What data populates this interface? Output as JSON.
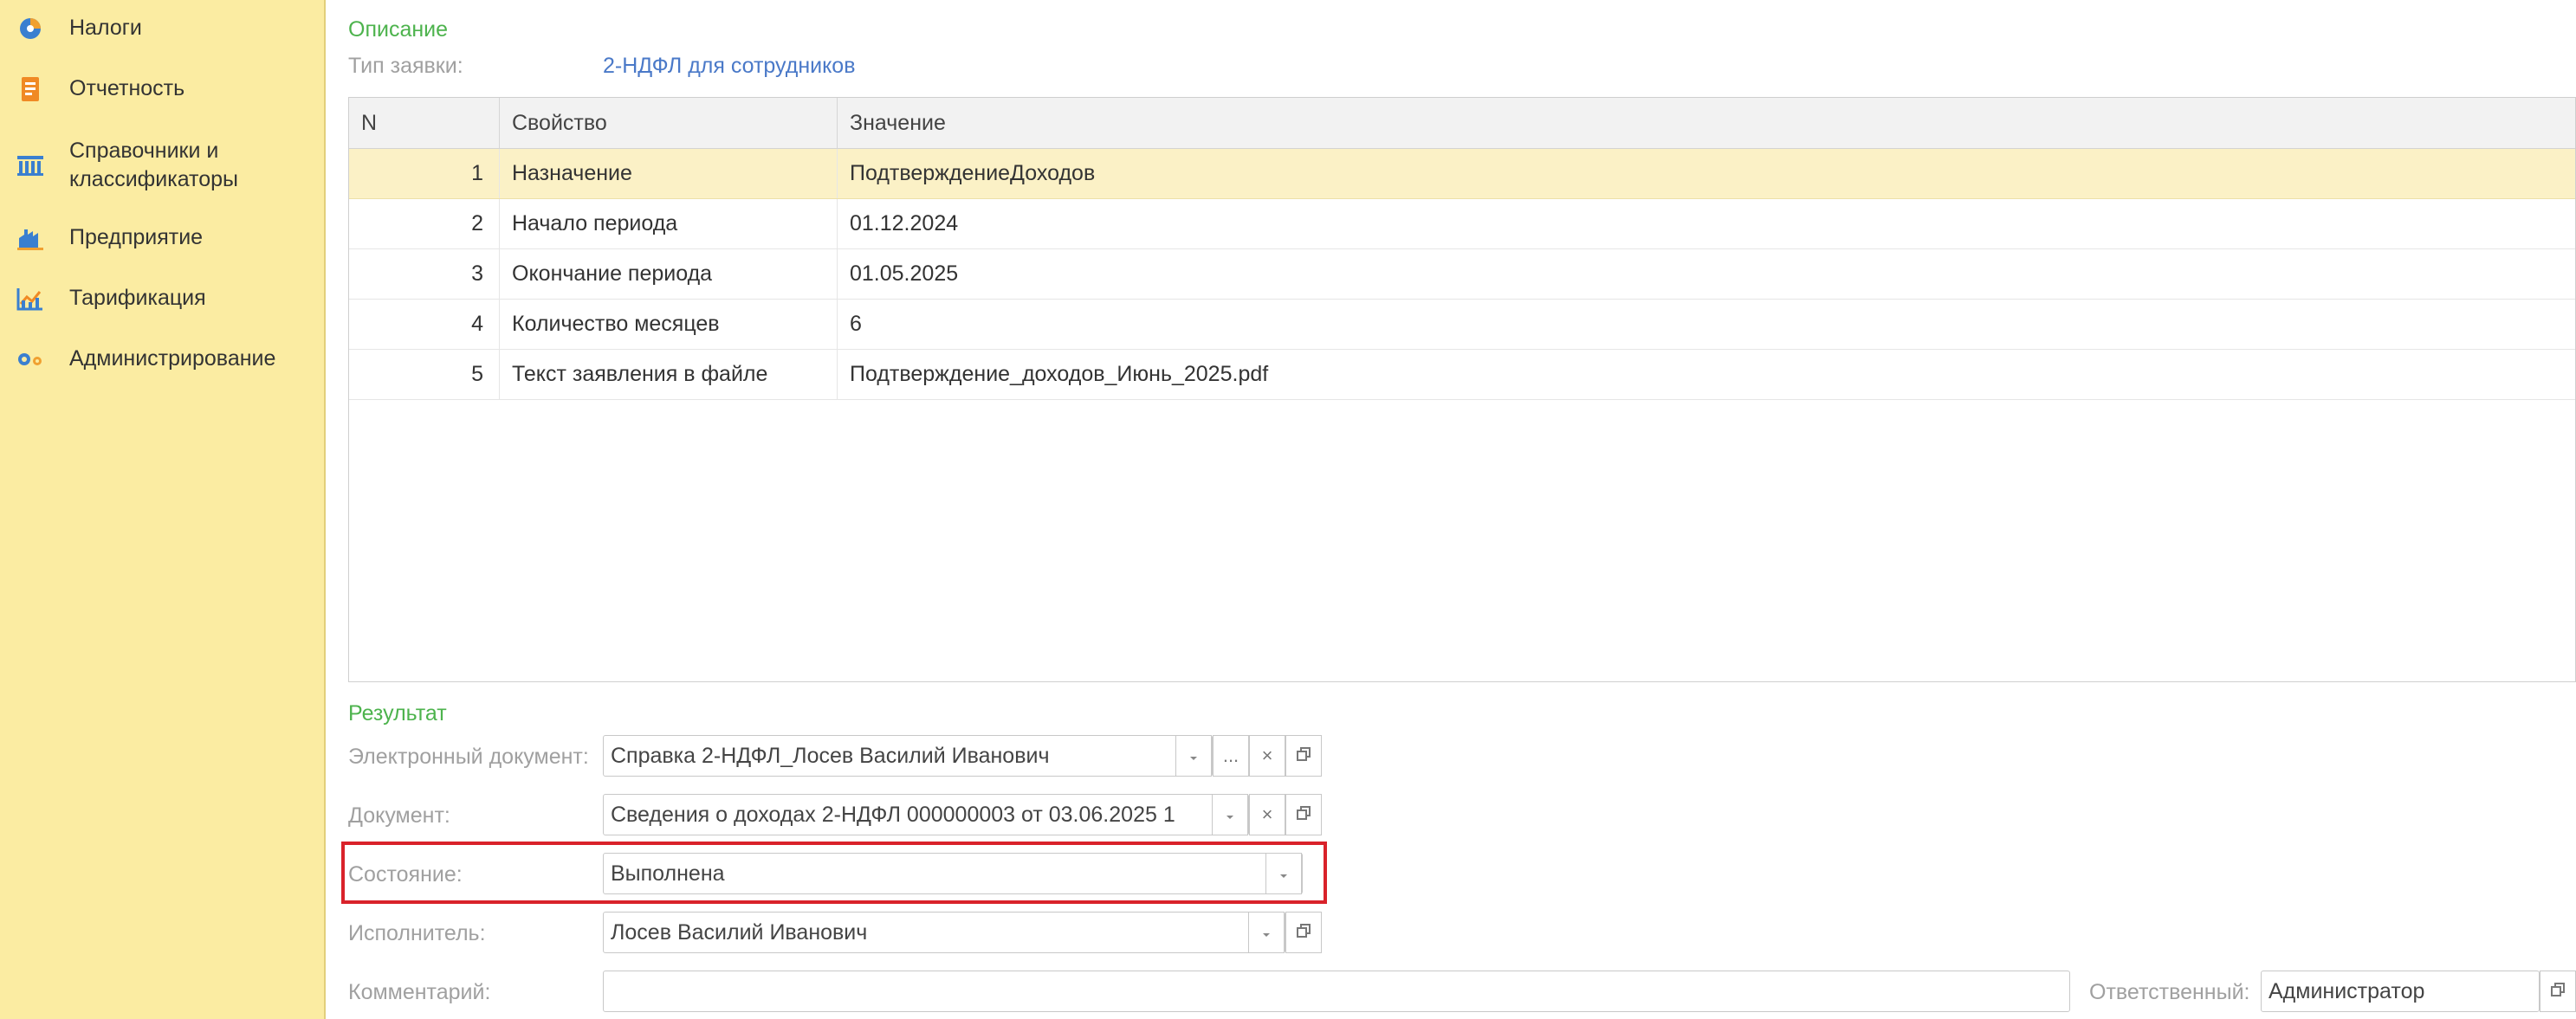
{
  "sidebar": {
    "items": [
      {
        "label": "Налоги",
        "icon": "taxes-icon"
      },
      {
        "label": "Отчетность",
        "icon": "reports-icon"
      },
      {
        "label": "Справочники и",
        "label2": "классификаторы",
        "icon": "catalogs-icon"
      },
      {
        "label": "Предприятие",
        "icon": "enterprise-icon"
      },
      {
        "label": "Тарификация",
        "icon": "tariff-icon"
      },
      {
        "label": "Администрирование",
        "icon": "admin-gears-icon"
      }
    ]
  },
  "description": {
    "section_title": "Описание",
    "request_type_label": "Тип заявки:",
    "request_type_value": "2-НДФЛ для сотрудников"
  },
  "table": {
    "columns": [
      "N",
      "Свойство",
      "Значение"
    ],
    "rows": [
      {
        "n": "1",
        "property": "Назначение",
        "value": "ПодтверждениеДоходов"
      },
      {
        "n": "2",
        "property": "Начало периода",
        "value": "01.12.2024"
      },
      {
        "n": "3",
        "property": "Окончание периода",
        "value": "01.05.2025"
      },
      {
        "n": "4",
        "property": "Количество месяцев",
        "value": "6"
      },
      {
        "n": "5",
        "property": "Текст заявления в файле",
        "value": "Подтверждение_доходов_Июнь_2025.pdf"
      }
    ]
  },
  "result": {
    "section_title": "Результат",
    "edoc_label": "Электронный документ:",
    "edoc_value": "Справка 2-НДФЛ_Лосев Василий Иванович",
    "doc_label": "Документ:",
    "doc_value": "Сведения о доходах 2-НДФЛ 000000003 от 03.06.2025 1",
    "state_label": "Состояние:",
    "state_value": "Выполнена",
    "executor_label": "Исполнитель:",
    "executor_value": "Лосев Василий Иванович",
    "comment_label": "Комментарий:",
    "comment_value": "",
    "responsible_label": "Ответственный:",
    "responsible_value": "Администратор"
  },
  "buttons": {
    "ellipsis": "...",
    "clear": "×"
  },
  "colors": {
    "sidebar_bg": "#fbeca2",
    "section_title": "#4db34d",
    "link": "#4a79c8",
    "selected_row": "#fbf1c6",
    "highlight_border": "#d9222a"
  }
}
